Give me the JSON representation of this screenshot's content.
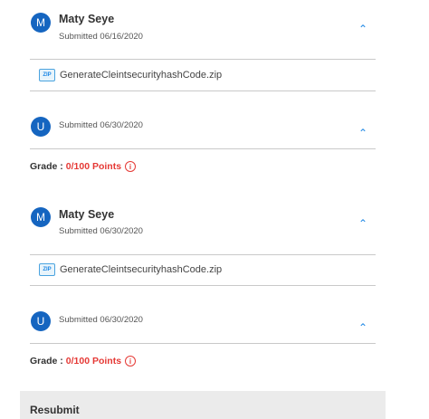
{
  "submissions": [
    {
      "avatar_letter": "M",
      "name": "Maty Seye",
      "submitted": "Submitted 06/16/2020",
      "file": "GenerateCleintsecurityhashCode.zip",
      "file_icon_text": "ZIP"
    },
    {
      "avatar_letter": "U",
      "submitted": "Submitted 06/30/2020",
      "grade_label": "Grade :",
      "grade_value": "0/100 Points"
    },
    {
      "avatar_letter": "M",
      "name": "Maty Seye",
      "submitted": "Submitted 06/30/2020",
      "file": "GenerateCleintsecurityhashCode.zip",
      "file_icon_text": "ZIP"
    },
    {
      "avatar_letter": "U",
      "submitted": "Submitted 06/30/2020",
      "grade_label": "Grade :",
      "grade_value": "0/100 Points"
    }
  ],
  "icons": {
    "collapse": "chevron-up-icon",
    "info": "info-icon",
    "file": "zip-file-icon"
  },
  "colors": {
    "avatar": "#1565c0",
    "accent": "#1e88e5",
    "grade": "#e53935"
  },
  "resubmit": {
    "label": "Resubmit"
  }
}
